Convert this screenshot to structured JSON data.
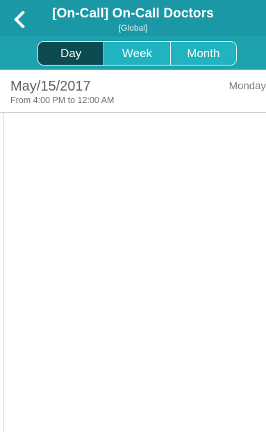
{
  "header": {
    "title": "[On-Call] On-Call Doctors",
    "subtitle": "[Global]",
    "back_icon": "chevron-left-icon",
    "background": "#1a98a5"
  },
  "tabs": [
    {
      "label": "Day",
      "active": true
    },
    {
      "label": "Week",
      "active": false
    },
    {
      "label": "Month",
      "active": false
    }
  ],
  "colors": {
    "accent": "#1ea2ae",
    "active_tab": "#0d4b52"
  },
  "schedule": {
    "entries": [
      {
        "date": "May/15/2017",
        "time_range": "From 4:00 PM to 12:00 AM",
        "weekday": "Monday"
      }
    ]
  }
}
